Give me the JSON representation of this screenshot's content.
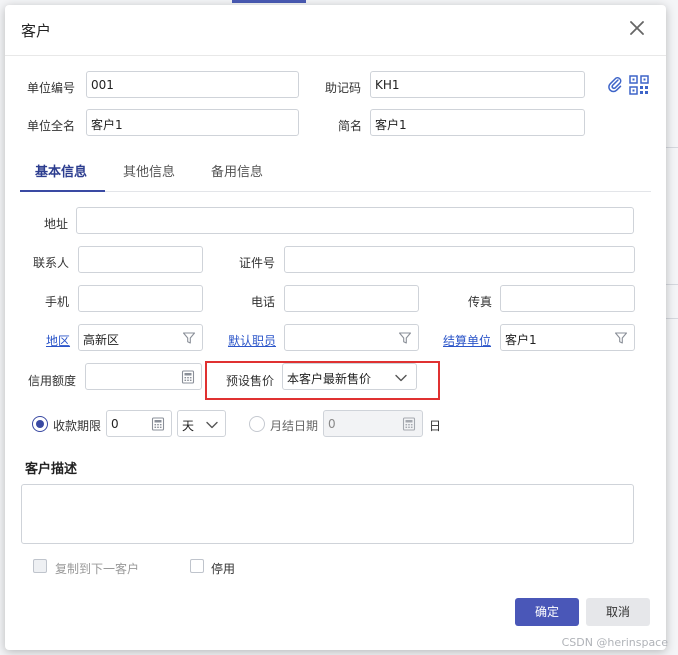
{
  "dialog": {
    "title": "客户"
  },
  "header_fields": {
    "unit_code_label": "单位编号",
    "unit_code_value": "001",
    "mnemonic_label": "助记码",
    "mnemonic_value": "KH1",
    "full_name_label": "单位全名",
    "full_name_value": "客户1",
    "short_name_label": "简名",
    "short_name_value": "客户1"
  },
  "tabs": [
    {
      "label": "基本信息",
      "active": true
    },
    {
      "label": "其他信息",
      "active": false
    },
    {
      "label": "备用信息",
      "active": false
    }
  ],
  "basic": {
    "address_label": "地址",
    "contact_label": "联系人",
    "id_no_label": "证件号",
    "mobile_label": "手机",
    "phone_label": "电话",
    "fax_label": "传真",
    "region_label": "地区",
    "region_value": "高新区",
    "default_staff_label": "默认职员",
    "default_staff_value": "",
    "settle_unit_label": "结算单位",
    "settle_unit_value": "客户1",
    "credit_label": "信用额度",
    "preset_price_label": "预设售价",
    "preset_price_value": "本客户最新售价",
    "payment_term_label": "收款期限",
    "payment_term_value": "0",
    "payment_term_unit": "天",
    "monthly_settle_label": "月结日期",
    "monthly_settle_value": "0",
    "monthly_settle_unit": "日"
  },
  "description": {
    "title": "客户描述",
    "value": ""
  },
  "options": {
    "copy_next_label": "复制到下一客户",
    "disable_label": "停用"
  },
  "buttons": {
    "ok": "确定",
    "cancel": "取消"
  },
  "watermark": "CSDN @herinspace",
  "colors": {
    "primary": "#4a57b8",
    "highlight": "#e03131",
    "link": "#2b55c9"
  }
}
